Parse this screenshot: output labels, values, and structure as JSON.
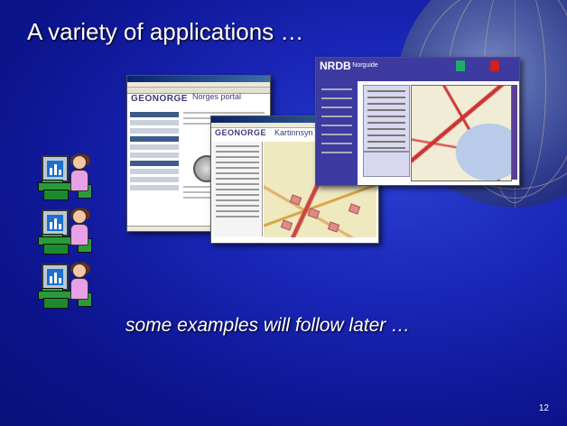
{
  "slide": {
    "title": "A variety of applications …",
    "subtitle": "some examples will follow later …",
    "page_number": "12"
  },
  "screenshots": {
    "geonorge": {
      "logo": "GEONORGE",
      "heading": "Norges portal"
    },
    "kartinnsyn": {
      "logo": "GEONORGE",
      "heading": "Kartinnsyn"
    },
    "nrdb": {
      "logo": "NRDB",
      "heading": "- Norguide"
    }
  },
  "colors": {
    "background": "#1a26b8",
    "text": "#ffffff"
  },
  "icons": [
    "person-at-computer-icon",
    "person-at-computer-icon",
    "person-at-computer-icon"
  ]
}
